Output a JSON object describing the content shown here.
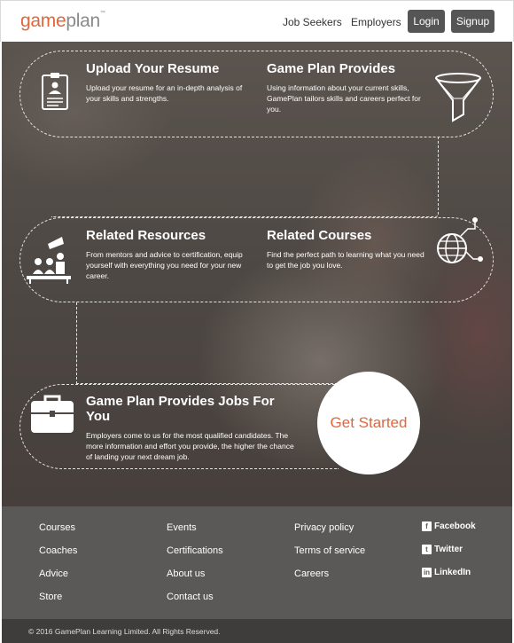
{
  "header": {
    "logo_game": "game",
    "logo_plan": "plan",
    "logo_tm": "™",
    "nav": [
      "Job Seekers",
      "Employers"
    ],
    "login_label": "Login",
    "signup_label": "Signup"
  },
  "hero": {
    "blocks": [
      {
        "title": "Upload Your Resume",
        "text": "Upload your resume for an in-depth analysis of your skills and strengths.",
        "icon": "resume-icon"
      },
      {
        "title": "Game Plan Provides",
        "text": "Using information about your current skills, GamePlan tailors skills and careers perfect for you.",
        "icon": "funnel-icon"
      },
      {
        "title": "Related Resources",
        "text": "From mentors and advice to certification, equip yourself with everything you need for your new career.",
        "icon": "presentation-icon"
      },
      {
        "title": "Related Courses",
        "text": "Find the perfect path to learning what you need to get the job you love.",
        "icon": "globe-network-icon"
      },
      {
        "title": "Game Plan Provides Jobs For You",
        "text": "Employers come to us for the most qualified candidates. The more information and effort you provide, the higher the chance of landing your next dream job.",
        "icon": "briefcase-icon"
      }
    ],
    "cta_label": "Get Started"
  },
  "footer": {
    "col1": [
      "Courses",
      "Coaches",
      "Advice",
      "Store"
    ],
    "col2": [
      "Events",
      "Certifications",
      "About us",
      "Contact us"
    ],
    "col3": [
      "Privacy policy",
      "Terms of service",
      "Careers"
    ],
    "social": [
      {
        "label": "Facebook",
        "glyph": "f",
        "icon": "facebook-icon"
      },
      {
        "label": "Twitter",
        "glyph": "t",
        "icon": "twitter-icon"
      },
      {
        "label": "LinkedIn",
        "glyph": "in",
        "icon": "linkedin-icon"
      }
    ],
    "copyright": "© 2016 GamePlan Learning Limited. All Rights Reserved."
  },
  "colors": {
    "accent": "#e0673b",
    "button": "#555555",
    "footer": "#5b5958",
    "footer_bottom": "#3f3d3c"
  }
}
